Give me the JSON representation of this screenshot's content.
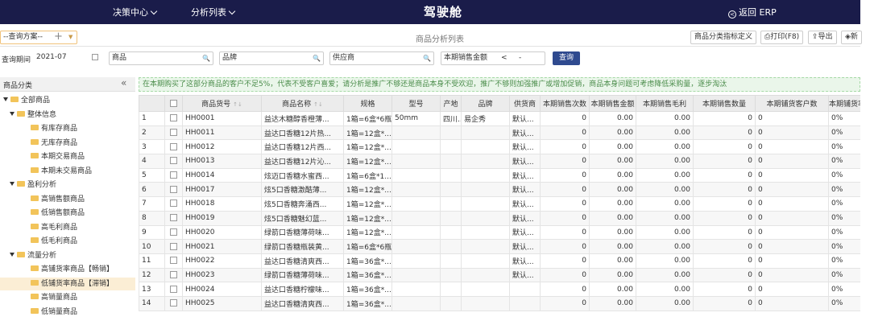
{
  "topbar": {
    "nav_decision": "决策中心",
    "nav_analysis": "分析列表",
    "brand": "驾驶舱",
    "back_erp": "返回 ERP"
  },
  "toolbar": {
    "scheme_label": "--查询方案--",
    "page_title": "商品分析列表",
    "btn_define": "商品分类指标定义",
    "btn_print": "打印(F8)",
    "btn_export": "导出",
    "btn_new": "新"
  },
  "filters": {
    "period_label": "查询期间",
    "period_value": "2021-07",
    "goods_label": "商品",
    "brand_label": "品牌",
    "supplier_label": "供应商",
    "sales_label": "本期销售金额",
    "op_value": "<",
    "op_value2": "-",
    "query_btn": "查询"
  },
  "sidebar": {
    "title": "商品分类",
    "collapse_icon": "«",
    "tree": [
      {
        "label": "全部商品",
        "level": 0,
        "expanded": true
      },
      {
        "label": "整体信息",
        "level": 1,
        "expanded": true
      },
      {
        "label": "有库存商品",
        "level": 2
      },
      {
        "label": "无库存商品",
        "level": 2
      },
      {
        "label": "本期交易商品",
        "level": 2
      },
      {
        "label": "本期未交易商品",
        "level": 2
      },
      {
        "label": "盈利分析",
        "level": 1,
        "expanded": true
      },
      {
        "label": "高销售额商品",
        "level": 2
      },
      {
        "label": "低销售额商品",
        "level": 2
      },
      {
        "label": "高毛利商品",
        "level": 2
      },
      {
        "label": "低毛利商品",
        "level": 2
      },
      {
        "label": "流量分析",
        "level": 1,
        "expanded": true
      },
      {
        "label": "高铺货率商品【畅销】",
        "level": 2
      },
      {
        "label": "低铺货率商品【滞销】",
        "level": 2,
        "selected": true
      },
      {
        "label": "高销量商品",
        "level": 2
      },
      {
        "label": "低销量商品",
        "level": 2
      }
    ]
  },
  "notice": "在本期购买了这部分商品的客户不足5%，代表不受客户喜爱；请分析是推广不够还是商品本身不受欢迎，推广不够则加强推广或增加促销，商品本身问题可考虑降低采购量，逐步淘汰",
  "table": {
    "columns": [
      "",
      "",
      "商品货号",
      "商品名称",
      "规格",
      "型号",
      "产地",
      "品牌",
      "供货商",
      "本期销售次数",
      "本期销售金额",
      "本期销售毛利",
      "本期销售数量",
      "本期铺货客户数",
      "本期铺货率"
    ],
    "rows": [
      [
        "1",
        "HH0001",
        "益达木糖醇香橙薄...",
        "1箱=6盒*6瓶",
        "50mm",
        "四川...",
        "易企秀",
        "默认...",
        "0",
        "0.00",
        "0.00",
        "0",
        "0",
        "0%"
      ],
      [
        "2",
        "HH0011",
        "益达口香糖12片热...",
        "1箱=12盒*...",
        "",
        "",
        "",
        "默认...",
        "0",
        "0.00",
        "0.00",
        "0",
        "0",
        "0%"
      ],
      [
        "3",
        "HH0012",
        "益达口香糖12片西...",
        "1箱=12盒*...",
        "",
        "",
        "",
        "默认...",
        "0",
        "0.00",
        "0.00",
        "0",
        "0",
        "0%"
      ],
      [
        "4",
        "HH0013",
        "益达口香糖12片沁...",
        "1箱=12盒*...",
        "",
        "",
        "",
        "默认...",
        "0",
        "0.00",
        "0.00",
        "0",
        "0",
        "0%"
      ],
      [
        "5",
        "HH0014",
        "炫迈口香糖水蜜西...",
        "1箱=6盒*1...",
        "",
        "",
        "",
        "默认...",
        "0",
        "0.00",
        "0.00",
        "0",
        "0",
        "0%"
      ],
      [
        "6",
        "HH0017",
        "炫5口香糖激酷薄...",
        "1箱=12盒*...",
        "",
        "",
        "",
        "默认...",
        "0",
        "0.00",
        "0.00",
        "0",
        "0",
        "0%"
      ],
      [
        "7",
        "HH0018",
        "炫5口香糖奔涌西...",
        "1箱=12盒*...",
        "",
        "",
        "",
        "默认...",
        "0",
        "0.00",
        "0.00",
        "0",
        "0",
        "0%"
      ],
      [
        "8",
        "HH0019",
        "炫5口香糖魅幻蓝...",
        "1箱=12盒*...",
        "",
        "",
        "",
        "默认...",
        "0",
        "0.00",
        "0.00",
        "0",
        "0",
        "0%"
      ],
      [
        "9",
        "HH0020",
        "绿箭口香糖薄荷味...",
        "1箱=12盒*...",
        "",
        "",
        "",
        "默认...",
        "0",
        "0.00",
        "0.00",
        "0",
        "0",
        "0%"
      ],
      [
        "10",
        "HH0021",
        "绿箭口香糖瓶装黄...",
        "1箱=6盒*6瓶",
        "",
        "",
        "",
        "默认...",
        "0",
        "0.00",
        "0.00",
        "0",
        "0",
        "0%"
      ],
      [
        "11",
        "HH0022",
        "益达口香糖清爽西...",
        "1箱=36盒*...",
        "",
        "",
        "",
        "默认...",
        "0",
        "0.00",
        "0.00",
        "0",
        "0",
        "0%"
      ],
      [
        "12",
        "HH0023",
        "绿箭口香糖薄荷味...",
        "1箱=36盒*...",
        "",
        "",
        "",
        "默认...",
        "0",
        "0.00",
        "0.00",
        "0",
        "0",
        "0%"
      ],
      [
        "13",
        "HH0024",
        "益达口香糖柠檬味...",
        "1箱=36盒*...",
        "",
        "",
        "",
        "",
        "0",
        "0.00",
        "0.00",
        "0",
        "0",
        "0%"
      ],
      [
        "14",
        "HH0025",
        "益达口香糖清爽西...",
        "1箱=36盒*...",
        "",
        "",
        "",
        "",
        "0",
        "0.00",
        "0.00",
        "0",
        "0",
        "0%"
      ]
    ]
  }
}
